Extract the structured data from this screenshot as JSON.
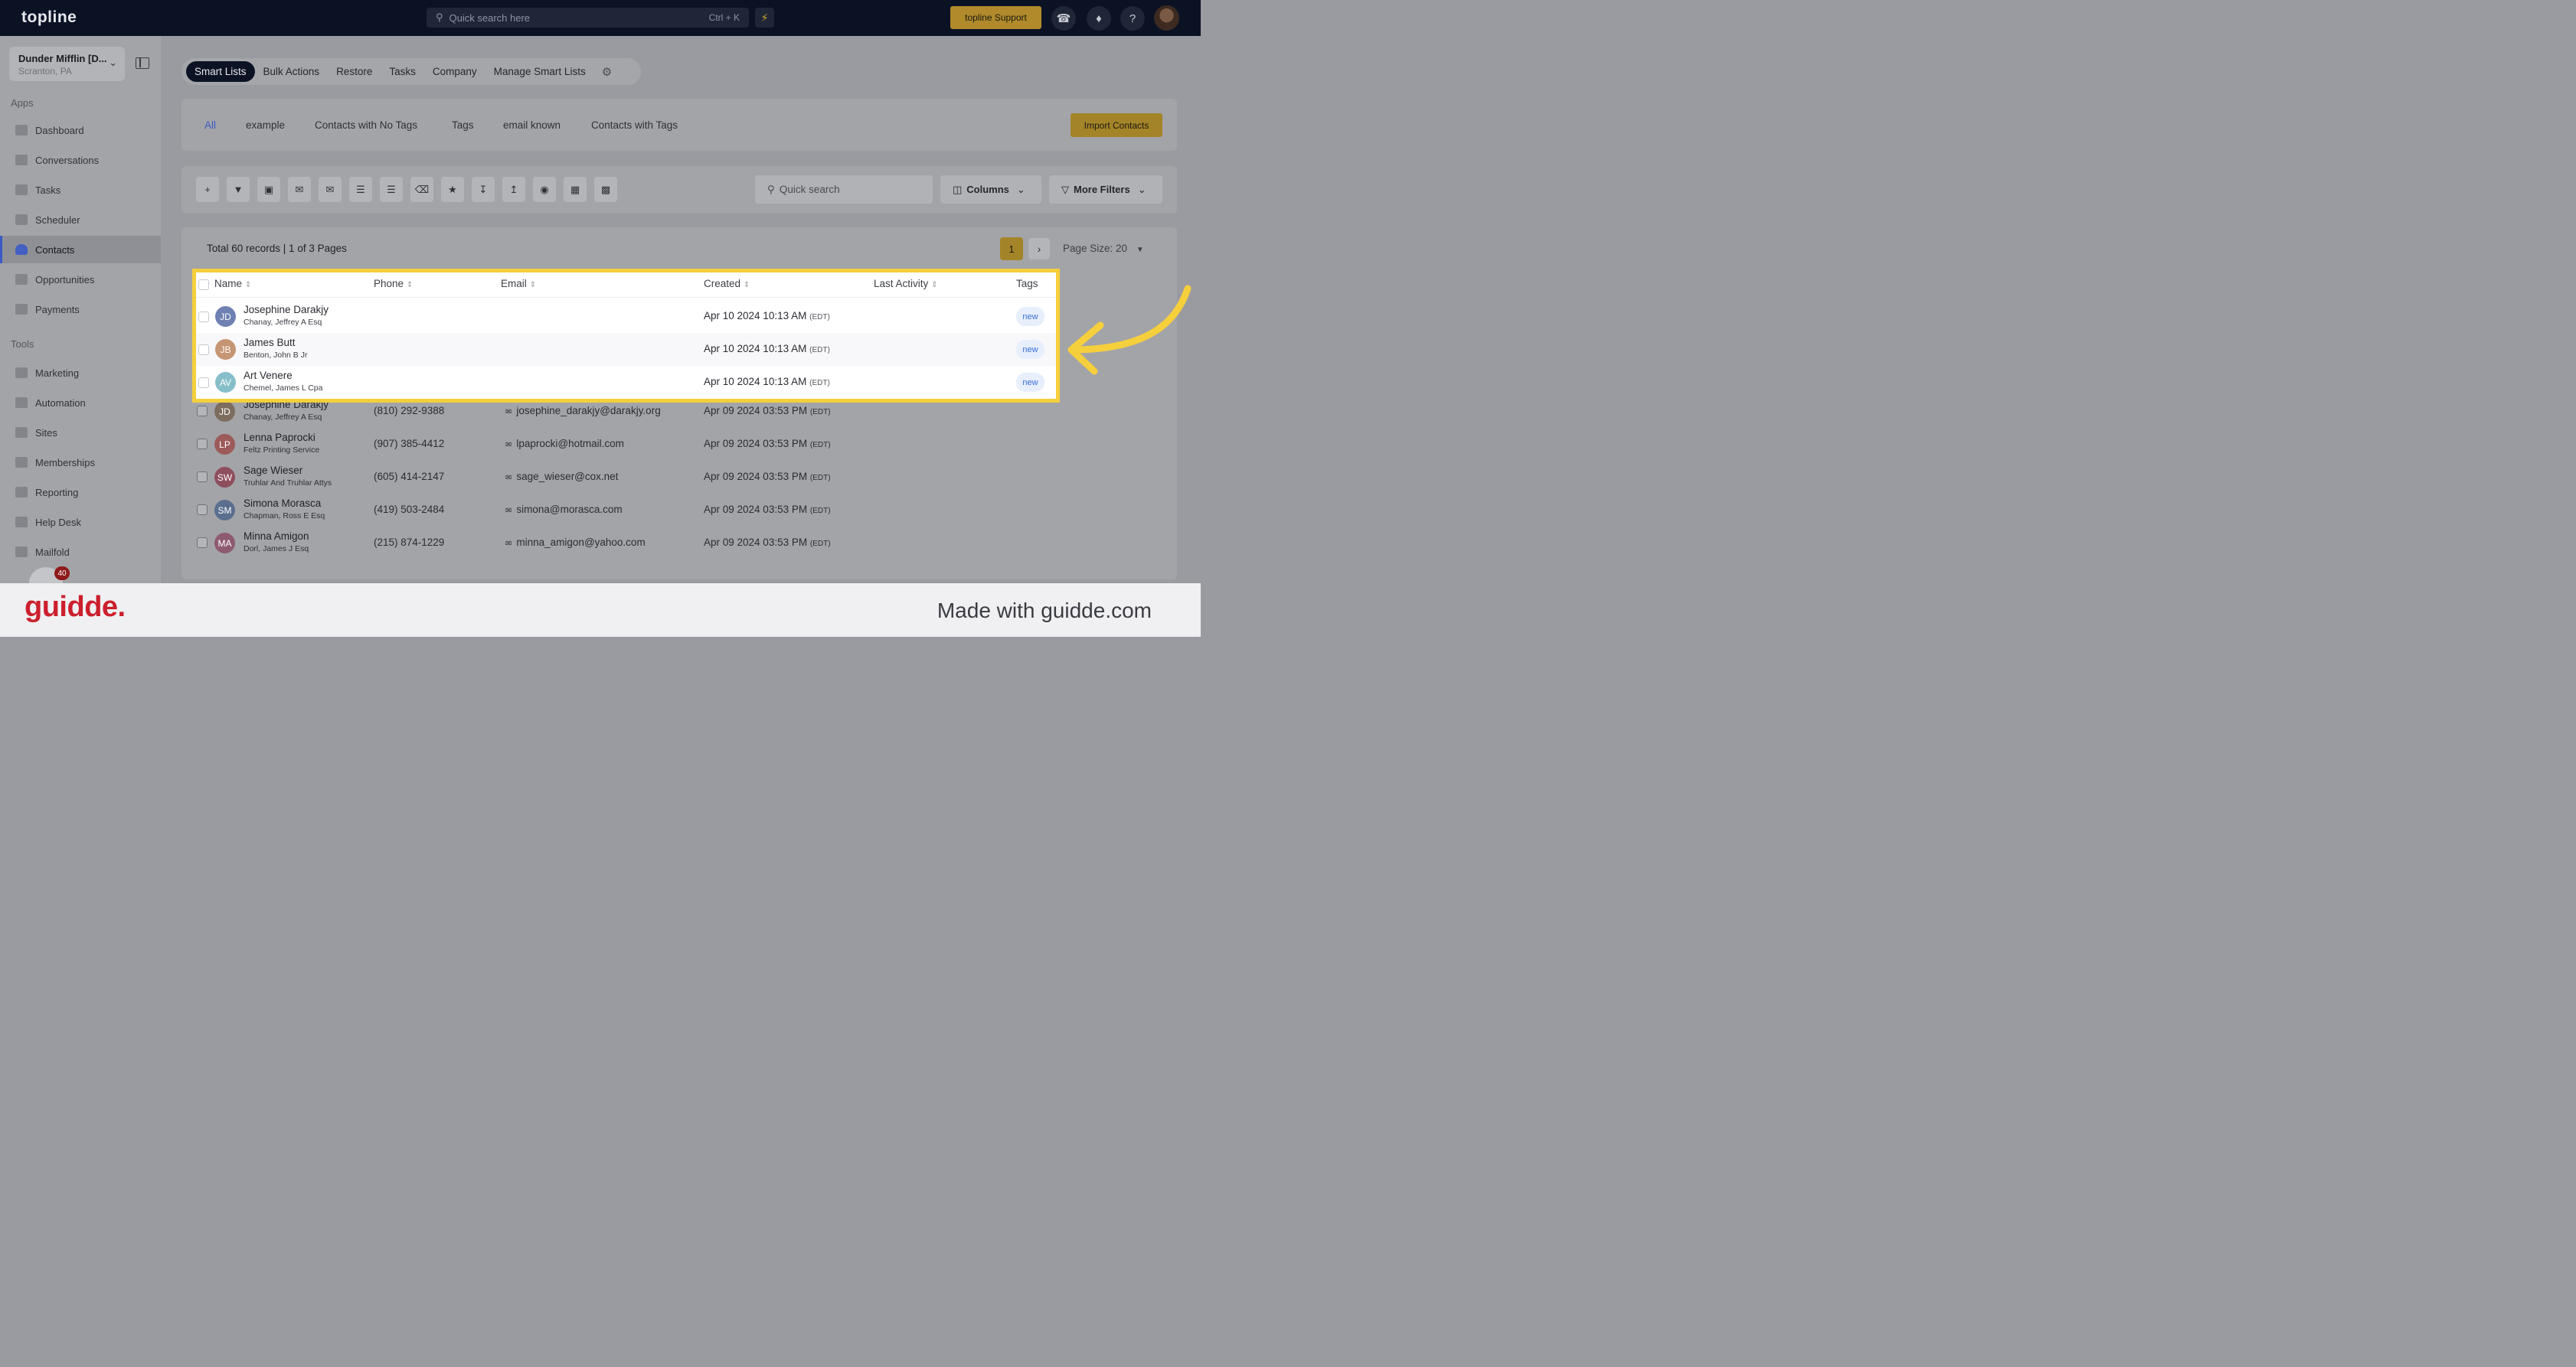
{
  "topbar": {
    "logo": "topline",
    "search_placeholder": "Quick search here",
    "search_shortcut": "Ctrl + K",
    "support_label": "topline Support"
  },
  "sidebar": {
    "account_name": "Dunder Mifflin [D...",
    "account_location": "Scranton, PA",
    "apps_label": "Apps",
    "tools_label": "Tools",
    "apps": [
      "Dashboard",
      "Conversations",
      "Tasks",
      "Scheduler",
      "Contacts",
      "Opportunities",
      "Payments"
    ],
    "tools": [
      "Marketing",
      "Automation",
      "Sites",
      "Memberships",
      "Reporting",
      "Help Desk",
      "Mailfold"
    ],
    "active_item": "Contacts",
    "notification_count": "40"
  },
  "top_tabs": [
    "Smart Lists",
    "Bulk Actions",
    "Restore",
    "Tasks",
    "Company",
    "Manage Smart Lists"
  ],
  "smart_list_tabs": [
    "All",
    "example",
    "Contacts with No Tags",
    "Tags",
    "email known",
    "Contacts with Tags"
  ],
  "import_label": "Import Contacts",
  "toolbar": {
    "search_placeholder": "Quick search",
    "columns_label": "Columns",
    "more_filters_label": "More Filters"
  },
  "records_summary": "Total 60 records | 1 of 3 Pages",
  "pagination": {
    "current_page": "1",
    "page_size_label": "Page Size: 20"
  },
  "columns": [
    "Name",
    "Phone",
    "Email",
    "Created",
    "Last Activity",
    "Tags"
  ],
  "highlighted_rows": [
    {
      "initials": "JD",
      "name": "Josephine Darakjy",
      "company": "Chanay, Jeffrey A Esq",
      "created": "Apr 10 2024 10:13 AM",
      "tz": "(EDT)",
      "tag": "new",
      "color": "#6f80b3"
    },
    {
      "initials": "JB",
      "name": "James Butt",
      "company": "Benton, John B Jr",
      "created": "Apr 10 2024 10:13 AM",
      "tz": "(EDT)",
      "tag": "new",
      "color": "#c69573"
    },
    {
      "initials": "AV",
      "name": "Art Venere",
      "company": "Chemel, James L Cpa",
      "created": "Apr 10 2024 10:13 AM",
      "tz": "(EDT)",
      "tag": "new",
      "color": "#86bfca"
    }
  ],
  "rows": [
    {
      "initials": "JD",
      "name": "Josephine Darakjy",
      "company": "Chanay, Jeffrey A Esq",
      "phone": "(810) 292-9388",
      "email": "josephine_darakjy@darakjy.org",
      "created": "Apr 09 2024 03:53 PM",
      "tz": "(EDT)",
      "color": "#7c6d5e"
    },
    {
      "initials": "LP",
      "name": "Lenna Paprocki",
      "company": "Feltz Printing Service",
      "phone": "(907) 385-4412",
      "email": "lpaprocki@hotmail.com",
      "created": "Apr 09 2024 03:53 PM",
      "tz": "(EDT)",
      "color": "#9c5a5a"
    },
    {
      "initials": "SW",
      "name": "Sage Wieser",
      "company": "Truhlar And Truhlar Attys",
      "phone": "(605) 414-2147",
      "email": "sage_wieser@cox.net",
      "created": "Apr 09 2024 03:53 PM",
      "tz": "(EDT)",
      "color": "#8e4e5e"
    },
    {
      "initials": "SM",
      "name": "Simona Morasca",
      "company": "Chapman, Ross E Esq",
      "phone": "(419) 503-2484",
      "email": "simona@morasca.com",
      "created": "Apr 09 2024 03:53 PM",
      "tz": "(EDT)",
      "color": "#5a6f8e"
    },
    {
      "initials": "MA",
      "name": "Minna Amigon",
      "company": "Dorl, James J Esq",
      "phone": "(215) 874-1229",
      "email": "minna_amigon@yahoo.com",
      "created": "Apr 09 2024 03:53 PM",
      "tz": "(EDT)",
      "color": "#8e5a72"
    }
  ],
  "footer": {
    "brand": "guidde.",
    "made_with": "Made with guidde.com"
  },
  "colors": {
    "accent": "#3b5ac6",
    "highlight": "#f5cf3c",
    "gold": "#b08a2b",
    "brand": "#cc1f2d"
  }
}
